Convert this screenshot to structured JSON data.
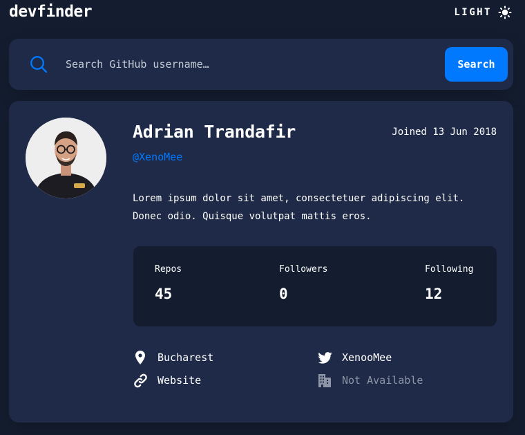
{
  "header": {
    "logo": "devfinder",
    "theme_label": "LIGHT",
    "theme_icon": "sun-icon"
  },
  "search": {
    "placeholder": "Search GitHub username…",
    "value": "",
    "button_label": "Search",
    "icon": "search-icon"
  },
  "profile": {
    "name": "Adrian Trandafir",
    "handle": "@XenoMee",
    "joined": "Joined 13 Jun 2018",
    "bio_lines": [
      "Lorem ipsum dolor sit amet, consectetuer adipiscing elit.",
      "Donec odio. Quisque volutpat mattis eros."
    ],
    "stats": {
      "repos_label": "Repos",
      "repos_value": "45",
      "followers_label": "Followers",
      "followers_value": "0",
      "following_label": "Following",
      "following_value": "12"
    },
    "links": {
      "location": "Bucharest",
      "website": "Website",
      "twitter": "XenooMee",
      "company": "Not Available"
    }
  },
  "colors": {
    "background": "#141D2F",
    "card": "#1E2A47",
    "accent": "#0079FF",
    "unavailable": "#8D95A6"
  }
}
